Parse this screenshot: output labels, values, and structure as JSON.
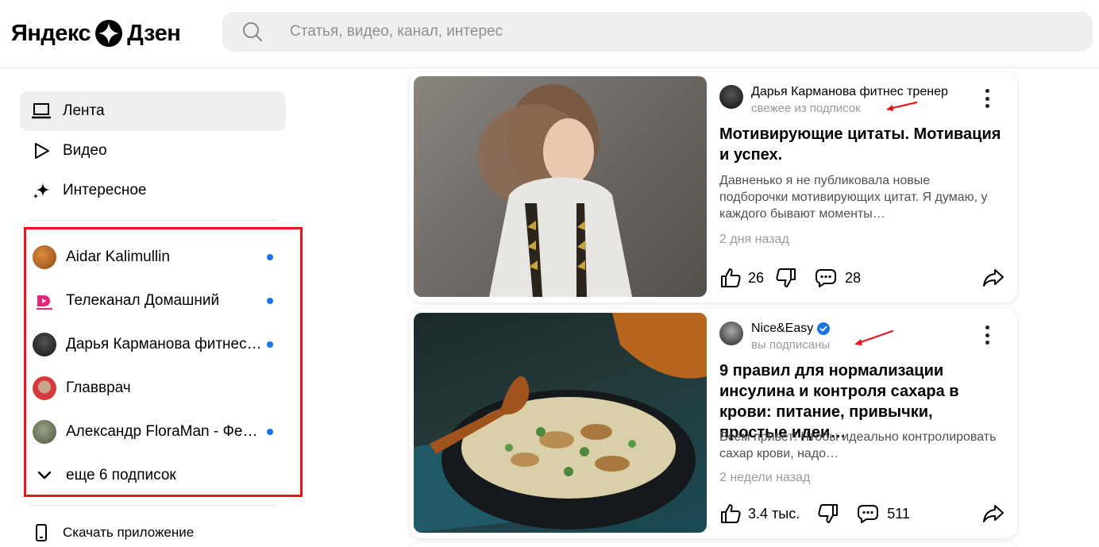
{
  "header": {
    "logo_left": "Яндекс",
    "logo_right": "Дзен",
    "search_placeholder": "Статья, видео, канал, интерес"
  },
  "sidebar": {
    "nav": [
      {
        "label": "Лента",
        "icon": "laptop-icon",
        "active": true
      },
      {
        "label": "Видео",
        "icon": "play-icon",
        "active": false
      },
      {
        "label": "Интересное",
        "icon": "sparkle-icon",
        "active": false
      }
    ],
    "subscriptions": [
      {
        "name": "Aidar Kalimullin",
        "unread": true
      },
      {
        "name": "Телеканал Домашний",
        "unread": true
      },
      {
        "name": "Дарья Карманова фитнес тренер",
        "unread": true
      },
      {
        "name": "Главврач",
        "unread": false
      },
      {
        "name": "Александр FloraMan - Фермер",
        "unread": true
      }
    ],
    "more_label": "еще 6 подписок",
    "download_label": "Скачать приложение"
  },
  "feed": [
    {
      "channel": "Дарья Карманова фитнес тренер",
      "verified": false,
      "status": "свежее из подписок",
      "title": "Мотивирующие цитаты. Мотивация и успех.",
      "snippet": "Давненько я не публиковала новые подборочки мотивирующих цитат. Я думаю, у каждого бывают моменты…",
      "date": "2 дня назад",
      "likes": "26",
      "comments": "28"
    },
    {
      "channel": "Nice&Easy",
      "verified": true,
      "status": "вы подписаны",
      "title": "9 правил для нормализации инсулина и контроля сахара в крови: питание, привычки, простые идеи…",
      "snippet": "Всем привет! Чтобы идеально контролировать сахар крови, надо…",
      "date": "2 недели назад",
      "likes": "3.4 тыс.",
      "comments": "511"
    }
  ],
  "colors": {
    "highlight_border": "#e8141b",
    "unread_dot": "#1a73e8",
    "verified_badge": "#1a73e8"
  }
}
